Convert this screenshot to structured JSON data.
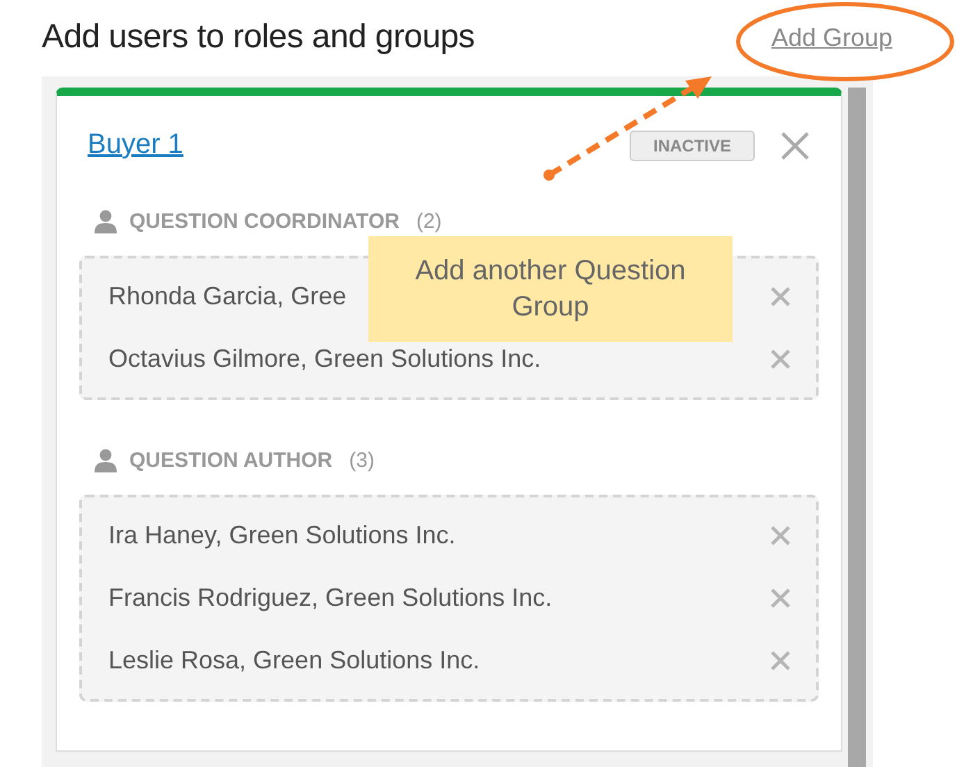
{
  "page_title": "Add users to roles and groups",
  "add_group_link": "Add Group",
  "group": {
    "name": "Buyer 1",
    "status_badge": "INACTIVE",
    "roles": [
      {
        "label": "QUESTION COORDINATOR",
        "count": "(2)",
        "members": [
          "Rhonda Garcia, Gree",
          "Octavius Gilmore, Green Solutions Inc."
        ]
      },
      {
        "label": "QUESTION AUTHOR",
        "count": "(3)",
        "members": [
          "Ira Haney, Green Solutions Inc.",
          "Francis Rodriguez, Green Solutions Inc.",
          "Leslie Rosa, Green Solutions Inc."
        ]
      }
    ]
  },
  "callout": {
    "text": "Add another Question Group"
  }
}
